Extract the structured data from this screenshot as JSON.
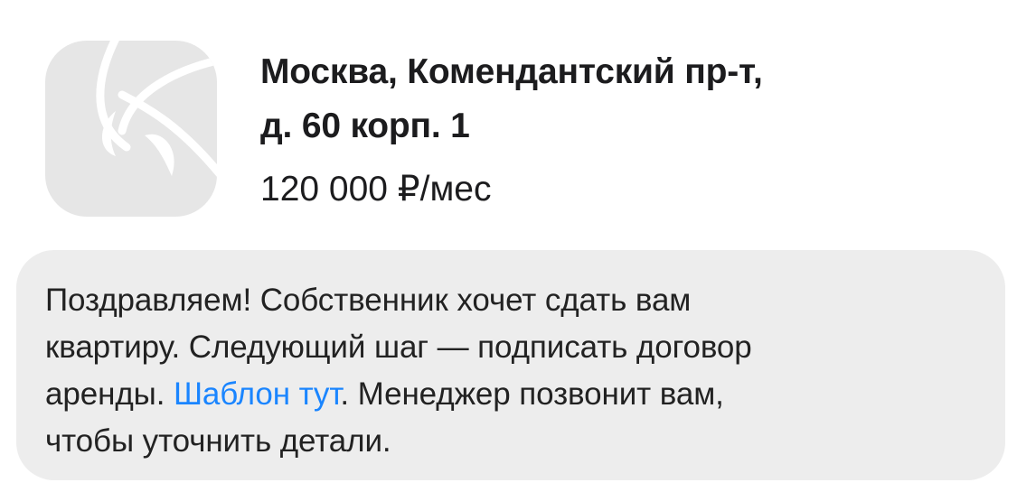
{
  "listing": {
    "thumbnail_icon": "placeholder-image-icon",
    "address_line1": "Москва, Комендантский пр-т,",
    "address_line2": "д. 60 корп. 1",
    "price": "120 000 ₽/мес"
  },
  "message": {
    "line1": "Поздравляем! Собственник хочет сдать вам",
    "line2": "квартиру. Следующий шаг — подписать договор",
    "line3_before_link": "аренды. ",
    "link_text": "Шаблон тут",
    "line3_after_link": ". Менеджер позвонит вам,",
    "line4": "чтобы уточнить детали."
  },
  "colors": {
    "bubble_background": "#ededed",
    "link": "#1a85ff",
    "thumbnail_background": "#e6e6e6"
  }
}
